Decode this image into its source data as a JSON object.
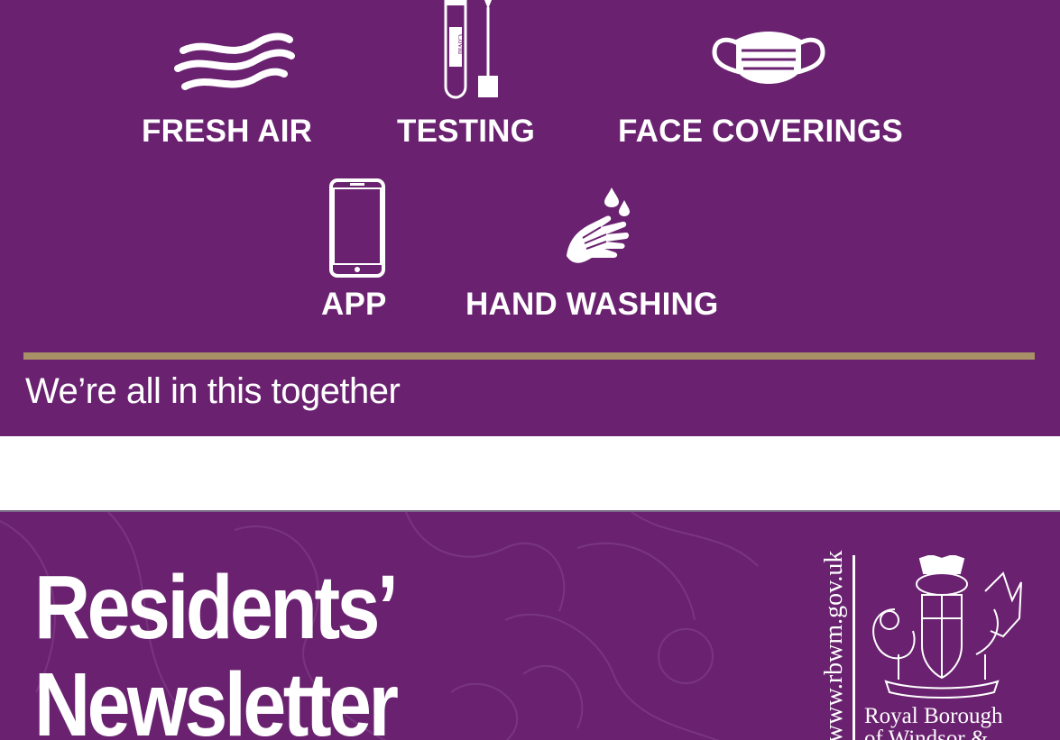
{
  "top_banner": {
    "items": [
      {
        "label": "FRESH AIR",
        "icon": "wind-icon"
      },
      {
        "label": "TESTING",
        "icon": "test-tube-icon",
        "tube_text": "Covid"
      },
      {
        "label": "FACE COVERINGS",
        "icon": "face-mask-icon"
      },
      {
        "label": "APP",
        "icon": "smartphone-icon"
      },
      {
        "label": "HAND WASHING",
        "icon": "hand-wash-icon"
      }
    ],
    "tagline": "We’re all in this together"
  },
  "newsletter": {
    "title_line1": "Residents’",
    "title_line2": "Newsletter",
    "url": "www.rbwm.gov.uk",
    "council_line1": "Royal Borough",
    "council_line2": "of Windsor &"
  },
  "colors": {
    "purple": "#6a2270",
    "gold_divider": "#a89067",
    "text": "#ffffff"
  }
}
